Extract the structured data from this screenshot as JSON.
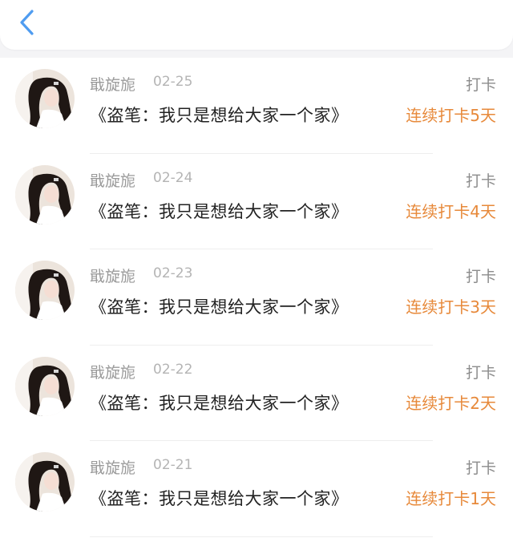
{
  "header": {
    "back_icon": "chevron-left-icon",
    "accent_color": "#4f9cf0"
  },
  "checkins": [
    {
      "user": "戢旋旎",
      "date": "02-25",
      "type": "打卡",
      "book": "《盗笔：我只是想给大家一个家》",
      "streak": "连续打卡5天"
    },
    {
      "user": "戢旋旎",
      "date": "02-24",
      "type": "打卡",
      "book": "《盗笔：我只是想给大家一个家》",
      "streak": "连续打卡4天"
    },
    {
      "user": "戢旋旎",
      "date": "02-23",
      "type": "打卡",
      "book": "《盗笔：我只是想给大家一个家》",
      "streak": "连续打卡3天"
    },
    {
      "user": "戢旋旎",
      "date": "02-22",
      "type": "打卡",
      "book": "《盗笔：我只是想给大家一个家》",
      "streak": "连续打卡2天"
    },
    {
      "user": "戢旋旎",
      "date": "02-21",
      "type": "打卡",
      "book": "《盗笔：我只是想给大家一个家》",
      "streak": "连续打卡1天"
    }
  ],
  "colors": {
    "streak": "#e7893a",
    "name": "#9a9a9a",
    "book": "#222222"
  }
}
